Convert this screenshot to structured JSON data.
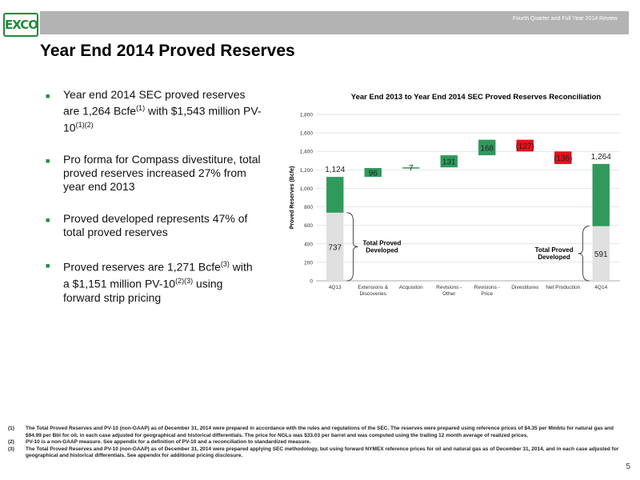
{
  "header": {
    "subtitle": "Fourth Quarter and Full Year 2014 Review",
    "logo_text": "EXCO"
  },
  "title": "Year End 2014 Proved Reserves",
  "bullets": [
    {
      "text": "Year end 2014 SEC proved reserves are 1,264 Bcfe",
      "sup1": "(1)",
      "text2": " with $1,543 million PV-10",
      "sup2": "(1)(2)"
    },
    {
      "text": "Pro forma for Compass divestiture, total proved reserves increased 27% from year end 2013"
    },
    {
      "text": "Proved developed represents 47% of total proved reserves"
    },
    {
      "text": "Proved reserves are 1,271 Bcfe",
      "sup1": "(3)",
      "text2": " with a $1,151 million PV-10",
      "sup2": "(2)(3)",
      "text3": " using forward strip pricing"
    }
  ],
  "chart_data": {
    "type": "bar",
    "title": "Year End 2013 to Year End 2014 SEC Proved Reserves Reconciliation",
    "ylabel": "Proved Reserves (Bcfe)",
    "ylim": [
      0,
      1800
    ],
    "yticks": [
      "0",
      "200",
      "400",
      "600",
      "800",
      "1,000",
      "1,200",
      "1,400",
      "1,600",
      "1,800"
    ],
    "categories": [
      "4Q13",
      "Extensions & Discoveries",
      "Acquisiton",
      "Revisions - Other",
      "Revisions - Price",
      "Divestitures",
      "Net Production",
      "4Q14"
    ],
    "category_lines": [
      [
        "4Q13"
      ],
      [
        "Extensions &",
        "Discoveries"
      ],
      [
        "Acquisiton"
      ],
      [
        "Revisions -",
        "Other"
      ],
      [
        "Revisions -",
        "Price"
      ],
      [
        "Divestitures"
      ],
      [
        "Net Production"
      ],
      [
        "4Q14"
      ]
    ],
    "bars": [
      {
        "kind": "total",
        "value": 1124,
        "label": "1,124",
        "developed": 737,
        "developed_label": "737"
      },
      {
        "kind": "delta",
        "start": 1124,
        "value": 96,
        "label": "96"
      },
      {
        "kind": "delta",
        "start": 1220,
        "value": 7,
        "label": "7"
      },
      {
        "kind": "delta",
        "start": 1227,
        "value": 131,
        "label": "131"
      },
      {
        "kind": "delta",
        "start": 1358,
        "value": 168,
        "label": "168"
      },
      {
        "kind": "delta",
        "start": 1526,
        "value": -127,
        "label": "(127)"
      },
      {
        "kind": "delta",
        "start": 1399,
        "value": -136,
        "label": "(136)"
      },
      {
        "kind": "total",
        "value": 1264,
        "label": "1,264",
        "developed": 591,
        "developed_label": "591"
      }
    ],
    "annotations": [
      "Total Proved Developed",
      "Total Proved Developed"
    ],
    "colors": {
      "positive": "#2f9a5c",
      "negative": "#e8101c",
      "developed": "#e0e0e0",
      "total_upper": "#2f9a5c"
    }
  },
  "footnotes": [
    {
      "num": "(1)",
      "text": "The Total Proved Reserves and PV-10 (non-GAAP) as of December 31, 2014 were prepared in accordance with the rules and regulations of the SEC. The reserves were prepared using reference prices of $4.35 per Mmbtu for natural gas and $94.99 per Bbl for oil, in each case adjusted for geographical and historical differentials. The price for NGLs was $33.03 per barrel and was computed using the trailing 12 month average of realized prices."
    },
    {
      "num": "(2)",
      "text": "PV-10 is a non-GAAP measure. See appendix for a definition of PV-10 and a reconciliation to standardized measure."
    },
    {
      "num": "(3)",
      "text": "The Total Proved Reserves and PV-10 (non-GAAP) as of December 31, 2014 were prepared applying SEC methodology, but using forward NYMEX reference prices for oil and natural gas as of December 31, 2014, and in each case adjusted for geographical and historical differentials. See appendix for additional pricing disclosure."
    }
  ],
  "page_number": "5"
}
